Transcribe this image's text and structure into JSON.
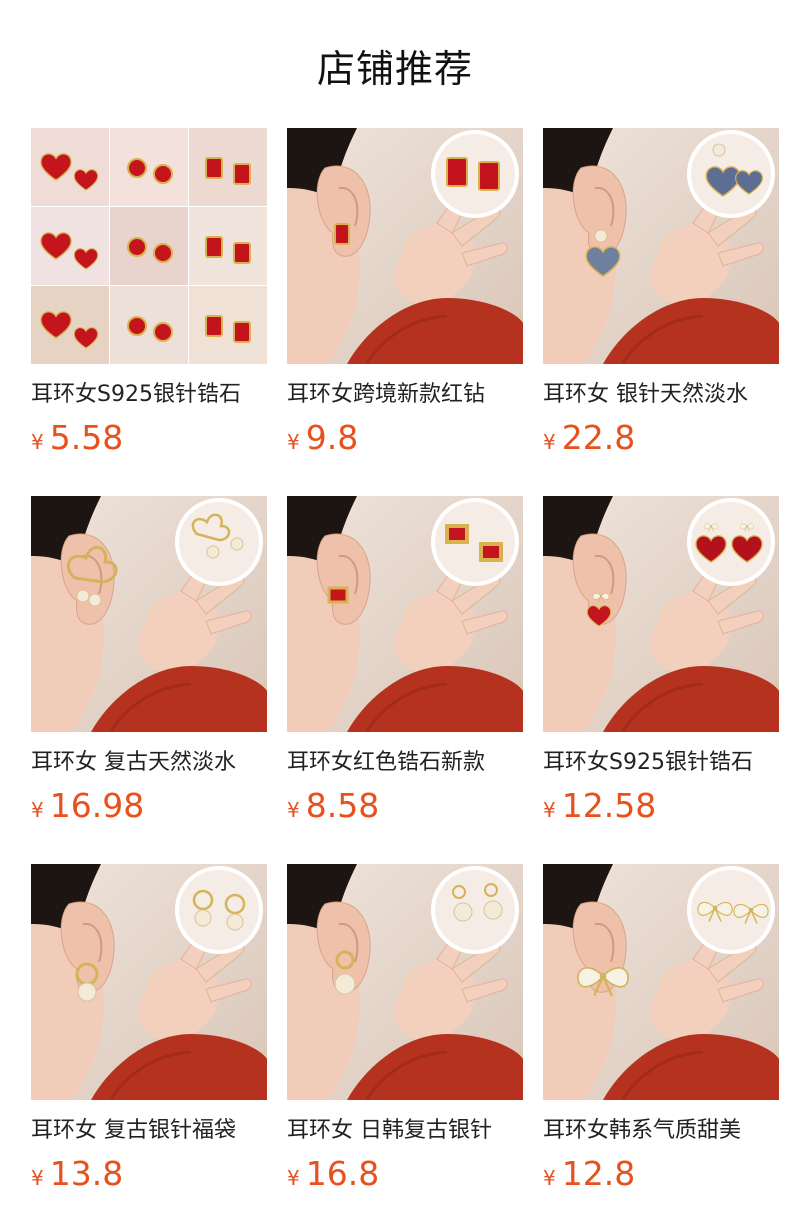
{
  "page": {
    "title": "店铺推荐"
  },
  "products": [
    {
      "name": "耳环女S925银针锆石",
      "currency": "¥",
      "price": "5.58",
      "thumb": "collage"
    },
    {
      "name": "耳环女跨境新款红钻",
      "currency": "¥",
      "price": "9.8",
      "thumb": "red-rect"
    },
    {
      "name": "耳环女 银针天然淡水",
      "currency": "¥",
      "price": "22.8",
      "thumb": "heart-shell"
    },
    {
      "name": "耳环女 复古天然淡水",
      "currency": "¥",
      "price": "16.98",
      "thumb": "pearl-flower"
    },
    {
      "name": "耳环女红色锆石新款",
      "currency": "¥",
      "price": "8.58",
      "thumb": "red-square"
    },
    {
      "name": "耳环女S925银针锆石",
      "currency": "¥",
      "price": "12.58",
      "thumb": "red-heart"
    },
    {
      "name": "耳环女 复古银针福袋",
      "currency": "¥",
      "price": "13.8",
      "thumb": "pearl-drop"
    },
    {
      "name": "耳环女 日韩复古银针",
      "currency": "¥",
      "price": "16.8",
      "thumb": "pearl-bow"
    },
    {
      "name": "耳环女韩系气质甜美",
      "currency": "¥",
      "price": "12.8",
      "thumb": "white-bow"
    }
  ],
  "colors": {
    "price": "#e8501c",
    "sweater": "#b5321f",
    "skin": "#f1cdb9",
    "hair": "#1c1512"
  }
}
